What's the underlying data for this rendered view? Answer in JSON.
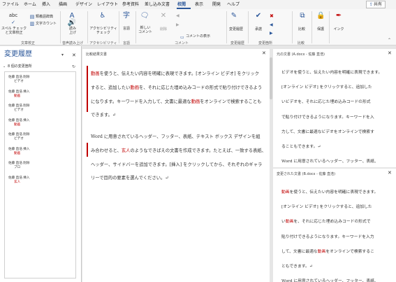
{
  "menu": {
    "tabs": [
      "ファイル",
      "ホーム",
      "挿入",
      "描画",
      "デザイン",
      "レイアウト",
      "参考資料",
      "差し込み文書",
      "校閲",
      "表示",
      "開発",
      "ヘルプ"
    ],
    "active": "校閲",
    "share": "共有"
  },
  "ribbon": {
    "spelling": "スペル チェック\nと文章校正",
    "thesaurus": "類義語辞典",
    "wordcount": "文字カウント",
    "group_proofing": "文章校正",
    "read_aloud": "読み\n上げ",
    "group_speech": "音声読み上げ",
    "accessibility": "アクセシビリティ\nチェック",
    "group_accessibility": "アクセシビリティ",
    "language": "言語",
    "group_language": "言語",
    "new_comment": "新しい\nコメント",
    "delete": "削除",
    "show_comments": "コメントの表示",
    "group_comments": "コメント",
    "track_changes": "変更履歴",
    "group_tracking": "変更履歴",
    "accept": "承諾",
    "group_changes": "変更箇所",
    "compare": "比較",
    "group_compare": "比較",
    "protect": "保護",
    "ink": "インク"
  },
  "history": {
    "title": "変更履歴",
    "count": "8 個の変更箇所",
    "items": [
      {
        "who": "佐藤 直浩 削除",
        "val": "ビデオ",
        "red": false
      },
      {
        "who": "佐藤 直浩 挿入",
        "val": "動画",
        "red": true
      },
      {
        "who": "佐藤 直浩 削除",
        "val": "ビデオ",
        "red": false
      },
      {
        "who": "佐藤 直浩 挿入",
        "val": "動画",
        "red": true
      },
      {
        "who": "佐藤 直浩 削除",
        "val": "ビデオ",
        "red": false
      },
      {
        "who": "佐藤 直浩 挿入",
        "val": "動画",
        "red": true
      },
      {
        "who": "佐藤 直浩 削除",
        "val": "プロ",
        "red": false
      },
      {
        "who": "佐藤 直浩 挿入",
        "val": "玄人",
        "red": true
      }
    ]
  },
  "compare_doc": {
    "title": "比較結果文書",
    "p1": [
      [
        {
          "t": "動画",
          "h": true
        },
        {
          "t": "を使うと、伝えたい内容を明確に表現できます。[オンライン ビデオ] をクリック"
        }
      ],
      [
        {
          "t": "すると、追加したい"
        },
        {
          "t": "動画",
          "h": true
        },
        {
          "t": "を、それに応じた埋め込みコードの形式で貼り付けできるよう"
        }
      ],
      [
        {
          "t": "になります。キーワードを入力して、文書に最適な"
        },
        {
          "t": "動画",
          "h": true
        },
        {
          "t": "をオンラインで検索することも"
        }
      ],
      [
        {
          "t": "できます。↵"
        }
      ]
    ],
    "p2": [
      [
        {
          "t": "Word に用意されているヘッダー、フッター、表紙、テキスト ボックス デザインを組"
        }
      ],
      [
        {
          "t": "み合わせると、"
        },
        {
          "t": "玄人",
          "h": true
        },
        {
          "t": "のようなできばえの文書を作成できます。たとえば、一致する表紙、"
        }
      ],
      [
        {
          "t": "ヘッダー、サイドバーを追加できます。[挿入] をクリックしてから、それぞれのギャラ"
        }
      ],
      [
        {
          "t": "リーで目的の要素を選んでください。↵"
        }
      ]
    ]
  },
  "original_doc": {
    "title": "元の文書 (A.docx - 佐藤 直浩)",
    "lines": [
      [
        {
          "t": "ビデオを使うと、伝えたい内容を明確に表現できます。"
        }
      ],
      [
        {
          "t": "[オンライン ビデオ] をクリックすると、追加した"
        }
      ],
      [
        {
          "t": "いビデオを、それに応じた埋め込みコードの形式"
        }
      ],
      [
        {
          "t": "で貼り付けできるようになります。キーワードを入"
        }
      ],
      [
        {
          "t": "力して、文書に最適なビデオをオンラインで検索す"
        }
      ],
      [
        {
          "t": "ることもできます。↵"
        }
      ],
      [
        {
          "t": "Word に用意されているヘッダー、フッター、表紙、"
        }
      ]
    ]
  },
  "revised_doc": {
    "title": "変更された文書 (B.docx - 佐藤 直浩)",
    "lines": [
      [
        {
          "t": "動画",
          "h": true
        },
        {
          "t": "を使うと、伝えたい内容を明確に表現できます。"
        }
      ],
      [
        {
          "t": "[オンライン ビデオ] をクリックすると、追加した"
        }
      ],
      [
        {
          "t": "い"
        },
        {
          "t": "動画",
          "h": true
        },
        {
          "t": "を、それに応じた埋め込みコードの形式で"
        }
      ],
      [
        {
          "t": "貼り付けできるようになります。キーワードを入力"
        }
      ],
      [
        {
          "t": "して、文書に最適な"
        },
        {
          "t": "動画",
          "h": true
        },
        {
          "t": "をオンラインで検索するこ"
        }
      ],
      [
        {
          "t": "ともできます。↵"
        }
      ],
      [
        {
          "t": "Word に用意されているヘッダー、フッター、表紙、"
        }
      ]
    ]
  },
  "colors": {
    "accent": "#2b579a",
    "change": "#c00000"
  }
}
